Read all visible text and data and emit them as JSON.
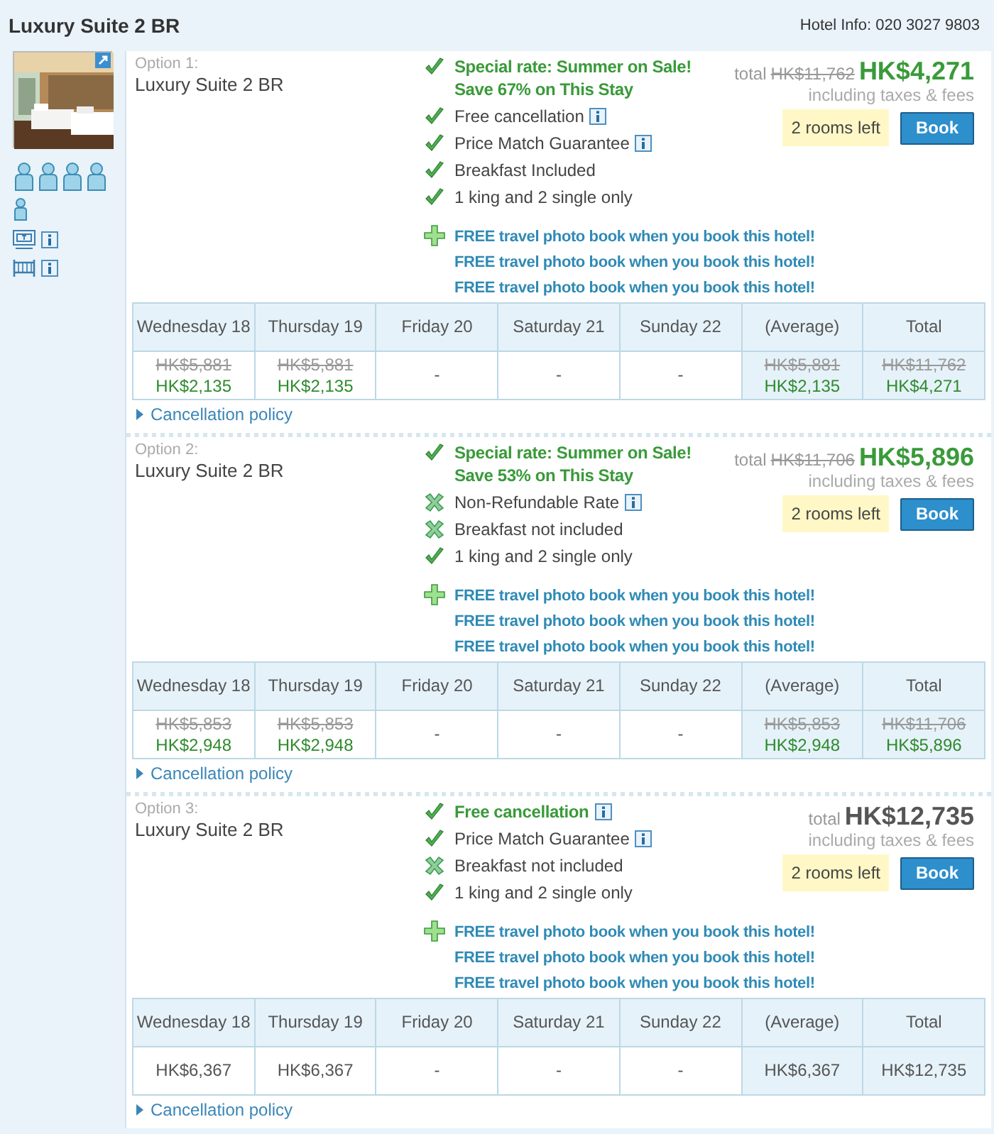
{
  "header": {
    "title": "Luxury Suite 2 BR",
    "hotel_info": "Hotel Info: 020 3027 9803"
  },
  "sidebar": {
    "amenities": [
      {
        "kind": "tv"
      },
      {
        "kind": "bed"
      }
    ]
  },
  "options": [
    {
      "label": "Option 1:",
      "room": "Luxury Suite 2 BR",
      "features": [
        {
          "kind": "check",
          "text": "Special rate: Summer on Sale! Save 67% on This Stay",
          "highlight": true,
          "info": false
        },
        {
          "kind": "check",
          "text": "Free cancellation",
          "highlight": false,
          "info": true
        },
        {
          "kind": "check",
          "text": "Price Match Guarantee",
          "highlight": false,
          "info": true
        },
        {
          "kind": "check",
          "text": "Breakfast Included",
          "highlight": false,
          "info": false
        },
        {
          "kind": "check",
          "text": "1 king and 2 single only",
          "highlight": false,
          "info": false
        }
      ],
      "promos": [
        "FREE travel photo book when you book this hotel!",
        "FREE travel photo book when you book this hotel!",
        "FREE travel photo book when you book this hotel!"
      ],
      "price": {
        "prefix": "total",
        "original": "HK$11,762",
        "amount": "HK$4,271",
        "sale": true,
        "note": "including taxes & fees"
      },
      "rooms_left": "2 rooms left",
      "book": "Book",
      "table": {
        "columns": [
          {
            "label": "Wednesday 18",
            "shaded": false
          },
          {
            "label": "Thursday 19",
            "shaded": false
          },
          {
            "label": "Friday 20",
            "shaded": false
          },
          {
            "label": "Saturday 21",
            "shaded": false
          },
          {
            "label": "Sunday 22",
            "shaded": false
          },
          {
            "label": "(Average)",
            "shaded": true
          },
          {
            "label": "Total",
            "shaded": true
          }
        ],
        "cells": [
          {
            "was": "HK$5,881",
            "now": "HK$2,135"
          },
          {
            "was": "HK$5,881",
            "now": "HK$2,135"
          },
          {
            "now": "-"
          },
          {
            "now": "-"
          },
          {
            "now": "-"
          },
          {
            "was": "HK$5,881",
            "now": "HK$2,135"
          },
          {
            "was": "HK$11,762",
            "now": "HK$4,271"
          }
        ]
      },
      "policy": "Cancellation policy"
    },
    {
      "label": "Option 2:",
      "room": "Luxury Suite 2 BR",
      "features": [
        {
          "kind": "check",
          "text": "Special rate: Summer on Sale! Save 53% on This Stay",
          "highlight": true,
          "info": false
        },
        {
          "kind": "cross",
          "text": "Non-Refundable Rate",
          "highlight": false,
          "info": true
        },
        {
          "kind": "cross",
          "text": "Breakfast not included",
          "highlight": false,
          "info": false
        },
        {
          "kind": "check",
          "text": "1 king and 2 single only",
          "highlight": false,
          "info": false
        }
      ],
      "promos": [
        "FREE travel photo book when you book this hotel!",
        "FREE travel photo book when you book this hotel!",
        "FREE travel photo book when you book this hotel!"
      ],
      "price": {
        "prefix": "total",
        "original": "HK$11,706",
        "amount": "HK$5,896",
        "sale": true,
        "note": "including taxes & fees"
      },
      "rooms_left": "2 rooms left",
      "book": "Book",
      "table": {
        "columns": [
          {
            "label": "Wednesday 18",
            "shaded": false
          },
          {
            "label": "Thursday 19",
            "shaded": false
          },
          {
            "label": "Friday 20",
            "shaded": false
          },
          {
            "label": "Saturday 21",
            "shaded": false
          },
          {
            "label": "Sunday 22",
            "shaded": false
          },
          {
            "label": "(Average)",
            "shaded": true
          },
          {
            "label": "Total",
            "shaded": true
          }
        ],
        "cells": [
          {
            "was": "HK$5,853",
            "now": "HK$2,948"
          },
          {
            "was": "HK$5,853",
            "now": "HK$2,948"
          },
          {
            "now": "-"
          },
          {
            "now": "-"
          },
          {
            "now": "-"
          },
          {
            "was": "HK$5,853",
            "now": "HK$2,948"
          },
          {
            "was": "HK$11,706",
            "now": "HK$5,896"
          }
        ]
      },
      "policy": "Cancellation policy"
    },
    {
      "label": "Option 3:",
      "room": "Luxury Suite 2 BR",
      "features": [
        {
          "kind": "check",
          "text": "Free cancellation",
          "highlight": true,
          "info": true
        },
        {
          "kind": "check",
          "text": "Price Match Guarantee",
          "highlight": false,
          "info": true
        },
        {
          "kind": "cross",
          "text": "Breakfast not included",
          "highlight": false,
          "info": false
        },
        {
          "kind": "check",
          "text": "1 king and 2 single only",
          "highlight": false,
          "info": false
        }
      ],
      "promos": [
        "FREE travel photo book when you book this hotel!",
        "FREE travel photo book when you book this hotel!",
        "FREE travel photo book when you book this hotel!"
      ],
      "price": {
        "prefix": "total",
        "amount": "HK$12,735",
        "sale": false,
        "note": "including taxes & fees"
      },
      "rooms_left": "2 rooms left",
      "book": "Book",
      "table": {
        "columns": [
          {
            "label": "Wednesday 18",
            "shaded": false
          },
          {
            "label": "Thursday 19",
            "shaded": false
          },
          {
            "label": "Friday 20",
            "shaded": false
          },
          {
            "label": "Saturday 21",
            "shaded": false
          },
          {
            "label": "Sunday 22",
            "shaded": false
          },
          {
            "label": "(Average)",
            "shaded": true
          },
          {
            "label": "Total",
            "shaded": true
          }
        ],
        "cells": [
          {
            "now": "HK$6,367"
          },
          {
            "now": "HK$6,367"
          },
          {
            "now": "-"
          },
          {
            "now": "-"
          },
          {
            "now": "-"
          },
          {
            "now": "HK$6,367"
          },
          {
            "now": "HK$12,735"
          }
        ]
      },
      "policy": "Cancellation policy"
    }
  ]
}
